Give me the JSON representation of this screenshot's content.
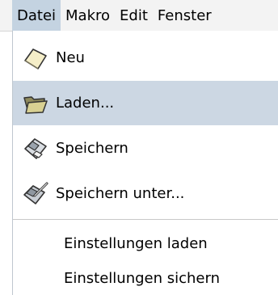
{
  "menubar": {
    "items": [
      {
        "label": "Datei"
      },
      {
        "label": "Makro"
      },
      {
        "label": "Edit"
      },
      {
        "label": "Fenster"
      }
    ],
    "active_item": "Datei"
  },
  "file_menu": {
    "items": [
      {
        "label": "Neu",
        "icon": "new-document-icon"
      },
      {
        "label": "Laden...",
        "icon": "open-folder-icon"
      },
      {
        "label": "Speichern",
        "icon": "save-disk-icon"
      },
      {
        "label": "Speichern unter...",
        "icon": "save-as-icon"
      },
      {
        "label": "Einstellungen laden"
      },
      {
        "label": "Einstellungen sichern"
      }
    ],
    "highlighted_item": "Laden..."
  },
  "colors": {
    "menubar_background": "#f3f3f3",
    "active_menu_highlight": "#c4d3e1",
    "hover_item_highlight": "#ccd7e3",
    "menu_background": "#ffffff",
    "separator": "#c8c8c8"
  }
}
